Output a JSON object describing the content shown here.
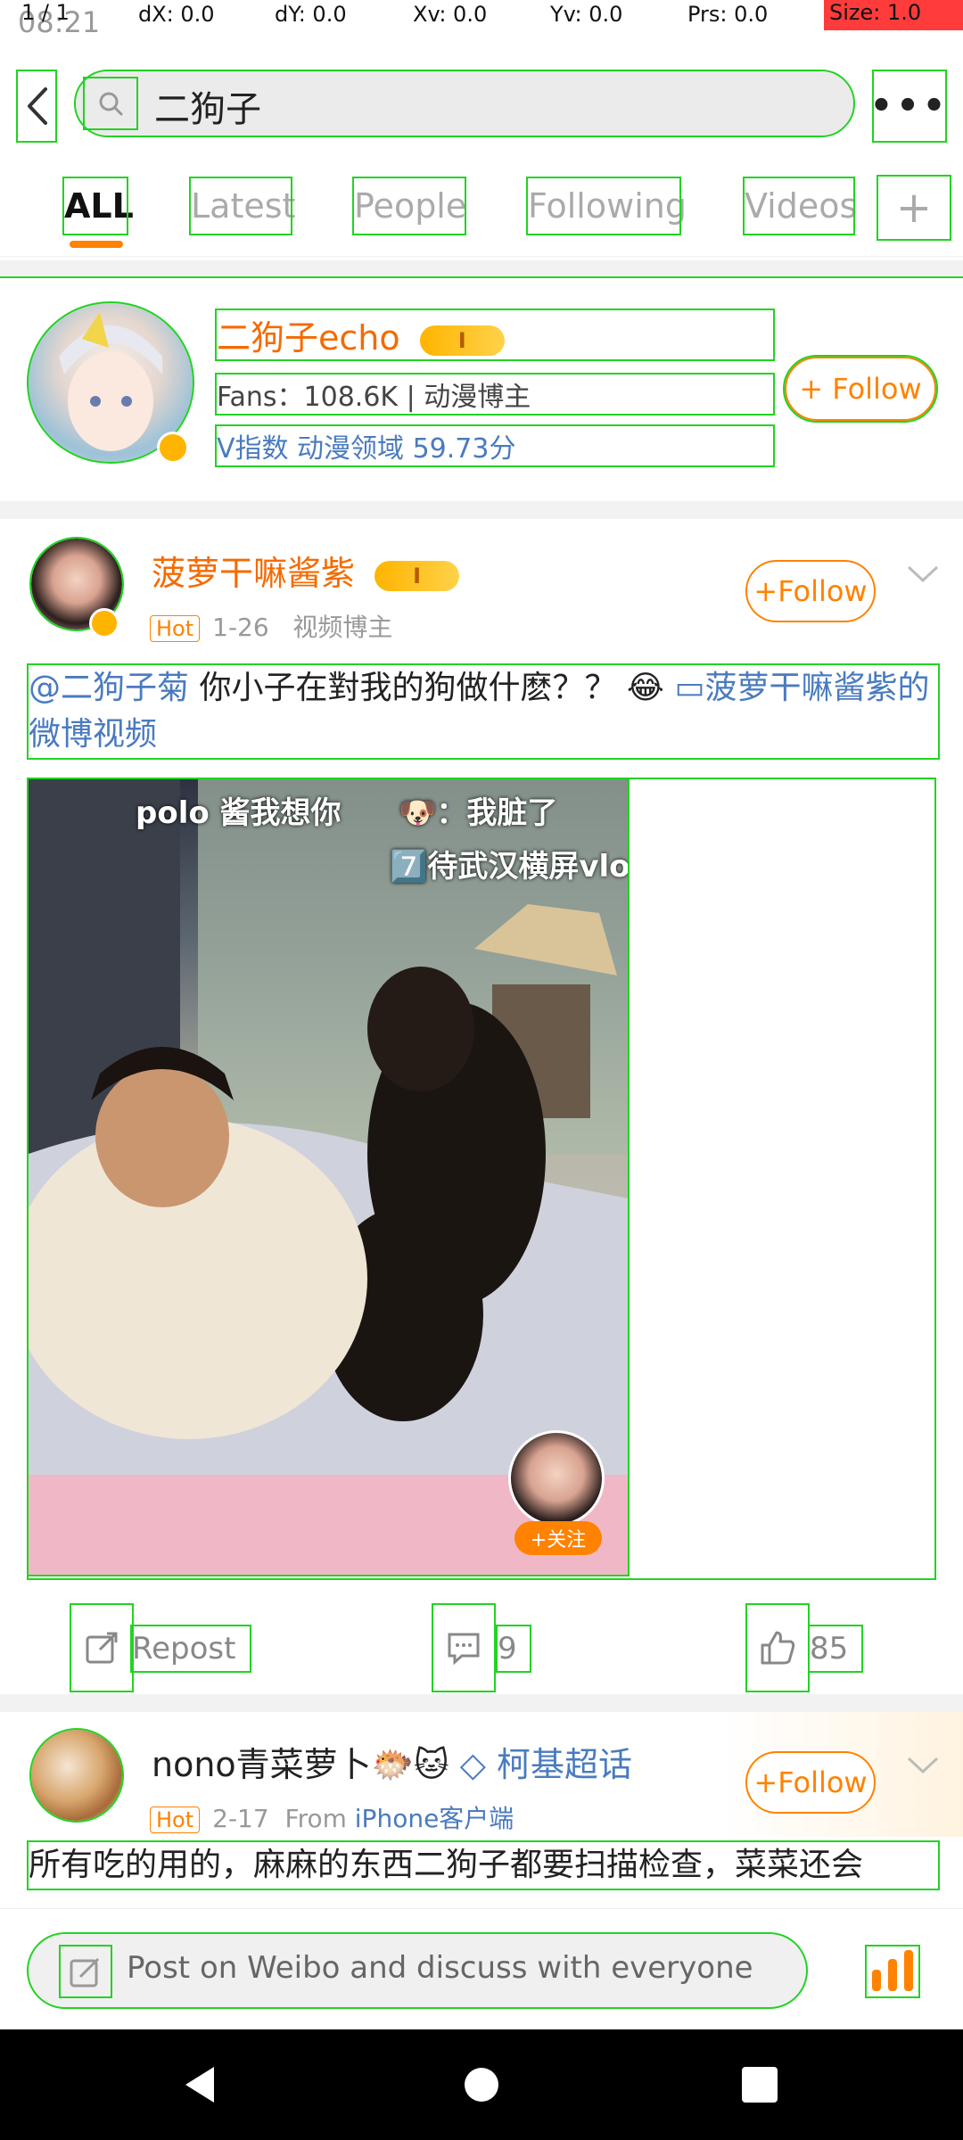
{
  "status": {
    "time": "08:21",
    "pointer": "1 / 1",
    "dx": "dX: 0.0",
    "dy": "dY: 0.0",
    "xv": "Xv: 0.0",
    "yv": "Yv: 0.0",
    "prs": "Prs: 0.0",
    "size": "Size: 1.0"
  },
  "search": {
    "query": "二狗子"
  },
  "tabs": [
    {
      "label": "ALL",
      "active": true
    },
    {
      "label": "Latest"
    },
    {
      "label": "People"
    },
    {
      "label": "Following"
    },
    {
      "label": "Videos"
    }
  ],
  "user_card": {
    "name": "二狗子echo",
    "vip_level": "I",
    "fans": "Fans：108.6K | 动漫博主",
    "index": "V指数 动漫领域 59.73分",
    "follow": "+ Follow"
  },
  "post1": {
    "author": "菠萝干嘛酱紫",
    "vip_level": "I",
    "hot": "Hot",
    "date": "1-26",
    "tag": "视频博主",
    "follow": "+Follow",
    "mention": "@二狗子菊",
    "text": " 你小子在對我的狗做什麽？？ 😂 ",
    "video_link": "菠萝干嘛酱紫的微博视频",
    "video_caption1": "polo 酱我想你",
    "video_caption2": "🐶：我脏了",
    "video_caption3": "7️⃣待武汉横屏vlo",
    "video_follow": "+关注"
  },
  "actions": {
    "repost": "Repost",
    "comments": "9",
    "likes": "85"
  },
  "post2": {
    "author": "nono青菜萝卜",
    "emojis": "🐡🐱",
    "super_topic": "柯基超话",
    "hot": "Hot",
    "date": "2-17",
    "from": "From",
    "source": "iPhone客户端",
    "follow": "+Follow",
    "text": "所有吃的用的，麻麻的东西二狗子都要扫描检查，菜菜还会"
  },
  "bottom": {
    "placeholder": "Post on Weibo and discuss with everyone"
  },
  "colors": {
    "accent": "#ff8200",
    "name_orange": "#f56a00",
    "link_blue": "#4a7bbf"
  }
}
